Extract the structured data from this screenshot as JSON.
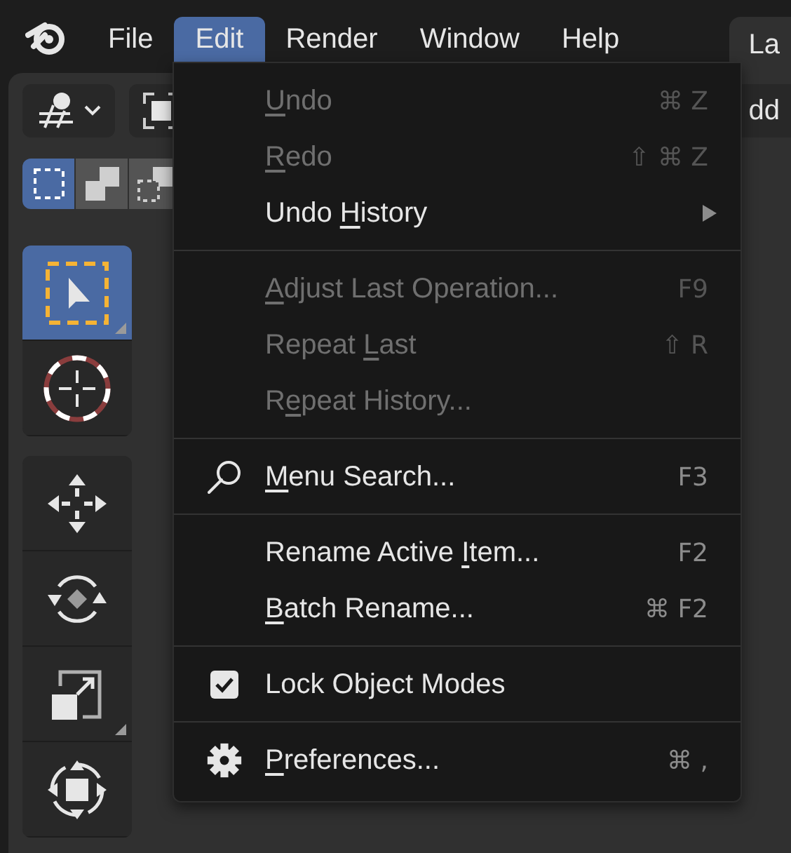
{
  "app_menu": [
    {
      "label": "File",
      "selected": false
    },
    {
      "label": "Edit",
      "selected": true
    },
    {
      "label": "Render",
      "selected": false
    },
    {
      "label": "Window",
      "selected": false
    },
    {
      "label": "Help",
      "selected": false
    }
  ],
  "workspace_tab": {
    "label": "La"
  },
  "header": {
    "add_button_label": "dd"
  },
  "select_modes": [
    {
      "selected": true
    },
    {
      "selected": false
    },
    {
      "selected": false
    }
  ],
  "tools": [
    {
      "kind": "select",
      "selected": true
    },
    {
      "kind": "cursor",
      "selected": false
    },
    {
      "kind": "move",
      "selected": false
    },
    {
      "kind": "rotate",
      "selected": false
    },
    {
      "kind": "scale",
      "selected": false
    },
    {
      "kind": "transform",
      "selected": false
    }
  ],
  "edit_menu": {
    "sections": [
      [
        {
          "kind": "plain",
          "label": {
            "key": "U",
            "after": "ndo"
          },
          "shortcut": "⌘ Z",
          "disabled": true
        },
        {
          "kind": "plain",
          "label": {
            "key": "R",
            "after": "edo"
          },
          "shortcut": "⇧ ⌘ Z",
          "disabled": true
        },
        {
          "kind": "submenu",
          "label": {
            "before": "Undo ",
            "key": "H",
            "after": "istory"
          },
          "disabled": false
        }
      ],
      [
        {
          "kind": "plain",
          "label": {
            "key": "A",
            "after": "djust Last Operation..."
          },
          "shortcut": "F9",
          "disabled": true
        },
        {
          "kind": "plain",
          "label": {
            "before": "Repeat ",
            "key": "L",
            "after": "ast"
          },
          "shortcut": "⇧ R",
          "disabled": true
        },
        {
          "kind": "plain",
          "label": {
            "before": "R",
            "key": "e",
            "after": "peat History..."
          },
          "disabled": true
        }
      ],
      [
        {
          "kind": "search",
          "label": {
            "key": "M",
            "after": "enu Search..."
          },
          "shortcut": "F3",
          "disabled": false
        }
      ],
      [
        {
          "kind": "plain",
          "label": {
            "before": "Rename Active ",
            "key": "I",
            "after": "tem..."
          },
          "shortcut": "F2",
          "disabled": false
        },
        {
          "kind": "plain",
          "label": {
            "key": "B",
            "after": "atch Rename..."
          },
          "shortcut": "⌘ F2",
          "disabled": false
        }
      ],
      [
        {
          "kind": "checkbox",
          "label": {
            "before": "Lock Object Modes"
          },
          "checked": true,
          "disabled": false
        }
      ],
      [
        {
          "kind": "settings",
          "label": {
            "key": "P",
            "after": "references..."
          },
          "shortcut": "⌘ ,",
          "disabled": false
        }
      ]
    ]
  }
}
